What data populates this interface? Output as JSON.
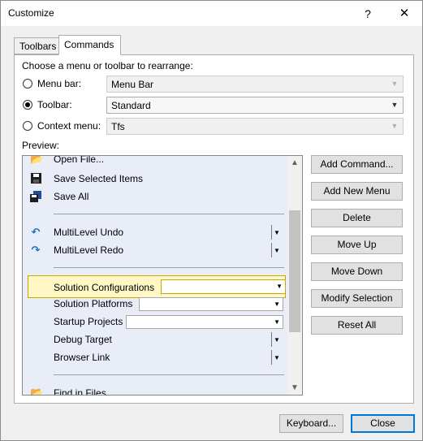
{
  "window": {
    "title": "Customize",
    "help_icon": "?",
    "close_icon": "✕"
  },
  "tabs": [
    {
      "label": "Toolbars",
      "active": false
    },
    {
      "label": "Commands",
      "active": true
    }
  ],
  "chooser": {
    "heading": "Choose a menu or toolbar to rearrange:",
    "menu_bar": {
      "label": "Menu bar:",
      "value": "Menu Bar",
      "checked": false,
      "enabled": false
    },
    "toolbar": {
      "label": "Toolbar:",
      "value": "Standard",
      "checked": true,
      "enabled": true
    },
    "context_menu": {
      "label": "Context menu:",
      "value": "Tfs",
      "checked": false,
      "enabled": false
    }
  },
  "preview": {
    "label": "Preview:",
    "items": {
      "open_file": "Open File...",
      "save_selected": "Save Selected Items",
      "save_all": "Save All",
      "undo": "MultiLevel Undo",
      "redo": "MultiLevel Redo",
      "solution_config": "Solution Configurations",
      "solution_platforms": "Solution Platforms",
      "startup_projects": "Startup Projects",
      "debug_target": "Debug Target",
      "browser_link": "Browser Link",
      "find_in_files": "Find in Files"
    }
  },
  "actions": {
    "add_command": "Add Command...",
    "add_new_menu": "Add New Menu",
    "delete": "Delete",
    "move_up": "Move Up",
    "move_down": "Move Down",
    "modify_selection": "Modify Selection",
    "reset_all": "Reset All"
  },
  "footer": {
    "keyboard": "Keyboard...",
    "close": "Close"
  },
  "colors": {
    "selection_border": "#c8a800",
    "selection_fill": "#fff8c4",
    "preview_bg": "#e8edf8",
    "accent": "#0078d7"
  }
}
